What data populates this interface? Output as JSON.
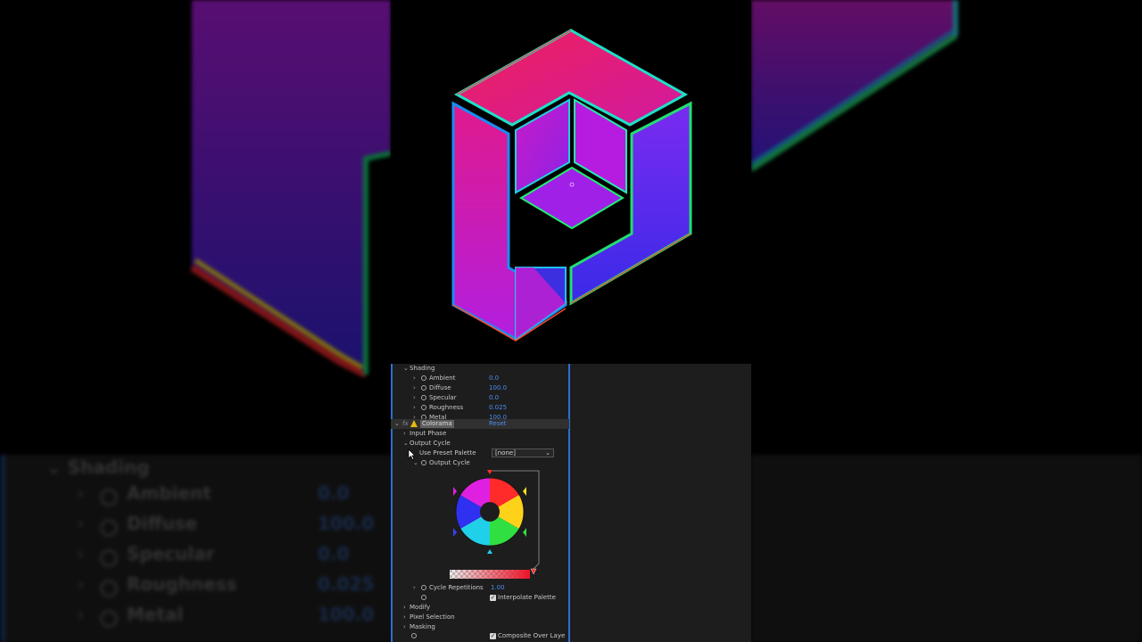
{
  "panel": {
    "shading_header": "Shading",
    "properties": [
      {
        "label": "Ambient",
        "value": "0.0"
      },
      {
        "label": "Diffuse",
        "value": "100.0"
      },
      {
        "label": "Specular",
        "value": "0.0"
      },
      {
        "label": "Roughness",
        "value": "0.025"
      },
      {
        "label": "Metal",
        "value": "100.0"
      }
    ],
    "fx_label": "fx",
    "effect_name": "Colorama",
    "reset_label": "Reset",
    "input_phase": "Input Phase",
    "output_cycle_group": "Output Cycle",
    "use_preset_palette": "Use Preset Palette",
    "preset_value": "[none]",
    "output_cycle_prop": "Output Cycle",
    "cycle_repetitions_label": "Cycle Repetitions",
    "cycle_repetitions_value": "1.00",
    "interpolate_palette": "Interpolate Palette",
    "modify": "Modify",
    "pixel_selection": "Pixel Selection",
    "masking": "Masking",
    "composite_over_layer": "Composite Over Laye",
    "interpolate_checked": true,
    "composite_checked": true
  },
  "colors": {
    "accent_blue": "#2d6fd1",
    "value_blue": "#4b8cf0",
    "warning_yellow": "#e5b90d",
    "logo_magenta": "#e0208a",
    "logo_blue": "#3b2fe0"
  }
}
